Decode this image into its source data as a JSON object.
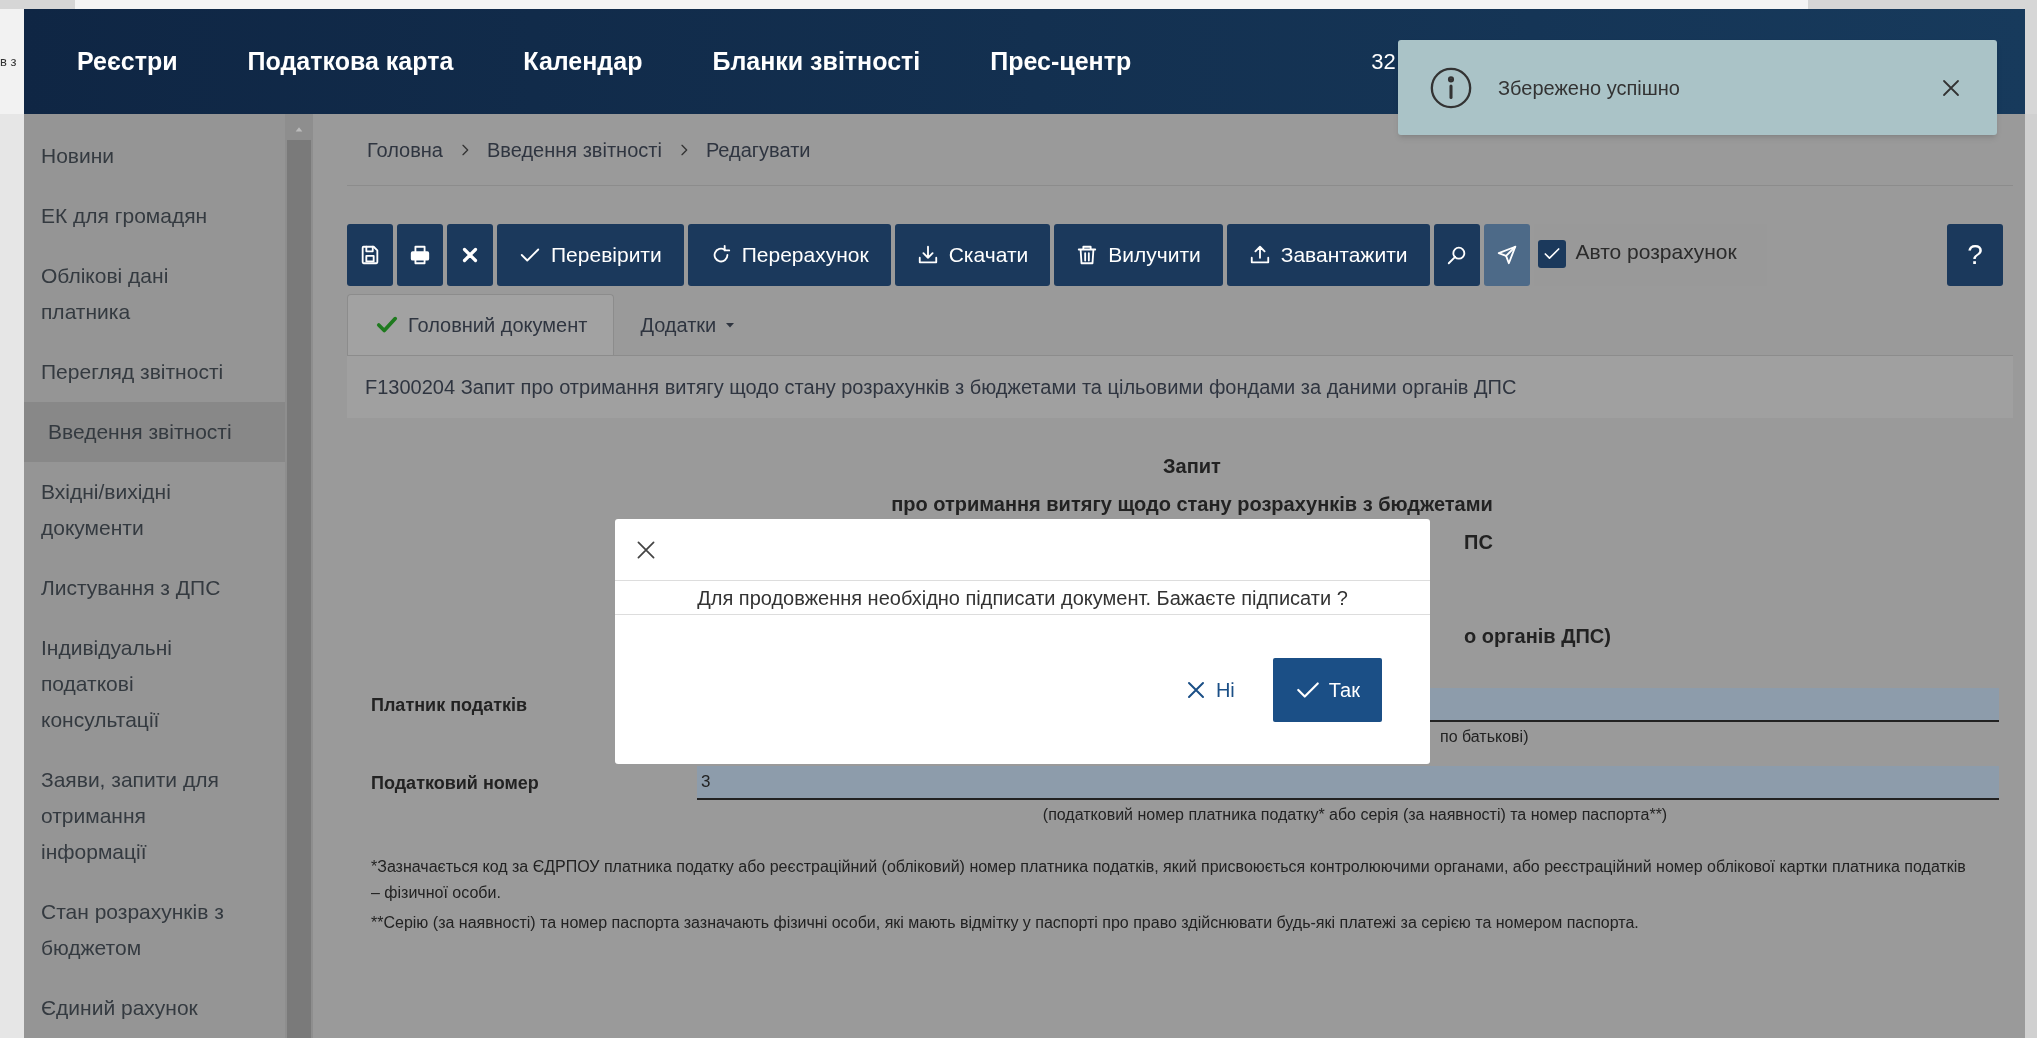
{
  "background_fragment": "в з",
  "nav": {
    "items": [
      "Реєстри",
      "Податкова карта",
      "Календар",
      "Бланки звітності",
      "Прес-центр"
    ],
    "account_fragment": "32"
  },
  "toast": {
    "message": "Збережено успішно"
  },
  "sidebar": {
    "items": [
      {
        "label": "Новини",
        "selected": false
      },
      {
        "label": "ЕК для громадян",
        "selected": false
      },
      {
        "label": "Облікові дані платника",
        "selected": false
      },
      {
        "label": "Перегляд звітності",
        "selected": false
      },
      {
        "label": "Введення звітності",
        "selected": true
      },
      {
        "label": "Вхідні/вихідні документи",
        "selected": false
      },
      {
        "label": "Листування з ДПС",
        "selected": false
      },
      {
        "label": "Індивідуальні податкові консультації",
        "selected": false
      },
      {
        "label": "Заяви, запити для отримання інформації",
        "selected": false
      },
      {
        "label": "Стан розрахунків з бюджетом",
        "selected": false
      },
      {
        "label": "Єдиний рахунок",
        "selected": false
      }
    ]
  },
  "breadcrumb": [
    "Головна",
    "Введення звітності",
    "Редагувати"
  ],
  "toolbar": {
    "buttons": [
      {
        "kind": "save"
      },
      {
        "kind": "print"
      },
      {
        "kind": "delete"
      },
      {
        "kind": "check",
        "label": "Перевірити"
      },
      {
        "kind": "recalc",
        "label": "Перерахунок"
      },
      {
        "kind": "download",
        "label": "Скачати"
      },
      {
        "kind": "trash",
        "label": "Вилучити"
      },
      {
        "kind": "upload",
        "label": "Завантажити"
      },
      {
        "kind": "key"
      },
      {
        "kind": "send"
      }
    ],
    "auto_calc": {
      "label": "Авто розрахунок",
      "checked": true
    },
    "help": "?"
  },
  "tabs": [
    {
      "label": "Головний документ",
      "selected": true,
      "kind": "main"
    },
    {
      "label": "Додатки",
      "selected": false,
      "kind": "dropdown"
    }
  ],
  "document": {
    "code_title": "F1300204 Запит про отримання витягу щодо стану розрахунків з бюджетами та цільовими фондами за даними органів ДПС",
    "heading": [
      "Запит",
      "про отримання витягу щодо стану розрахунків з бюджетами"
    ],
    "heading_fragments": [
      "ПС",
      "о органів ДПС)"
    ],
    "fields": [
      {
        "label": "Платник податків",
        "hint": "по батькові)",
        "hint_cut": true
      },
      {
        "label": "Податковий номер",
        "value": "3",
        "hint": "(податковий номер платника податку* або серія (за наявності) та номер паспорта**)",
        "hint_cut": false
      }
    ],
    "notes": [
      "*Зазначається код за ЄДРПОУ платника податку або реєстраційний (обліковий) номер платника податків, який присвоюється контролюючими органами, або реєстраційний номер облікової картки платника податків – фізичної особи.",
      "**Серію (за наявності) та номер паспорта зазначають фізичні особи, які мають відмітку у паспорті про право здійснювати будь-які платежі за серією та номером паспорта."
    ]
  },
  "dialog": {
    "message": "Для продовження необхідно підписати документ. Бажаєте підписати ?",
    "buttons": [
      {
        "kind": "cancel",
        "label": "Ні"
      },
      {
        "kind": "confirm",
        "label": "Так"
      }
    ]
  }
}
